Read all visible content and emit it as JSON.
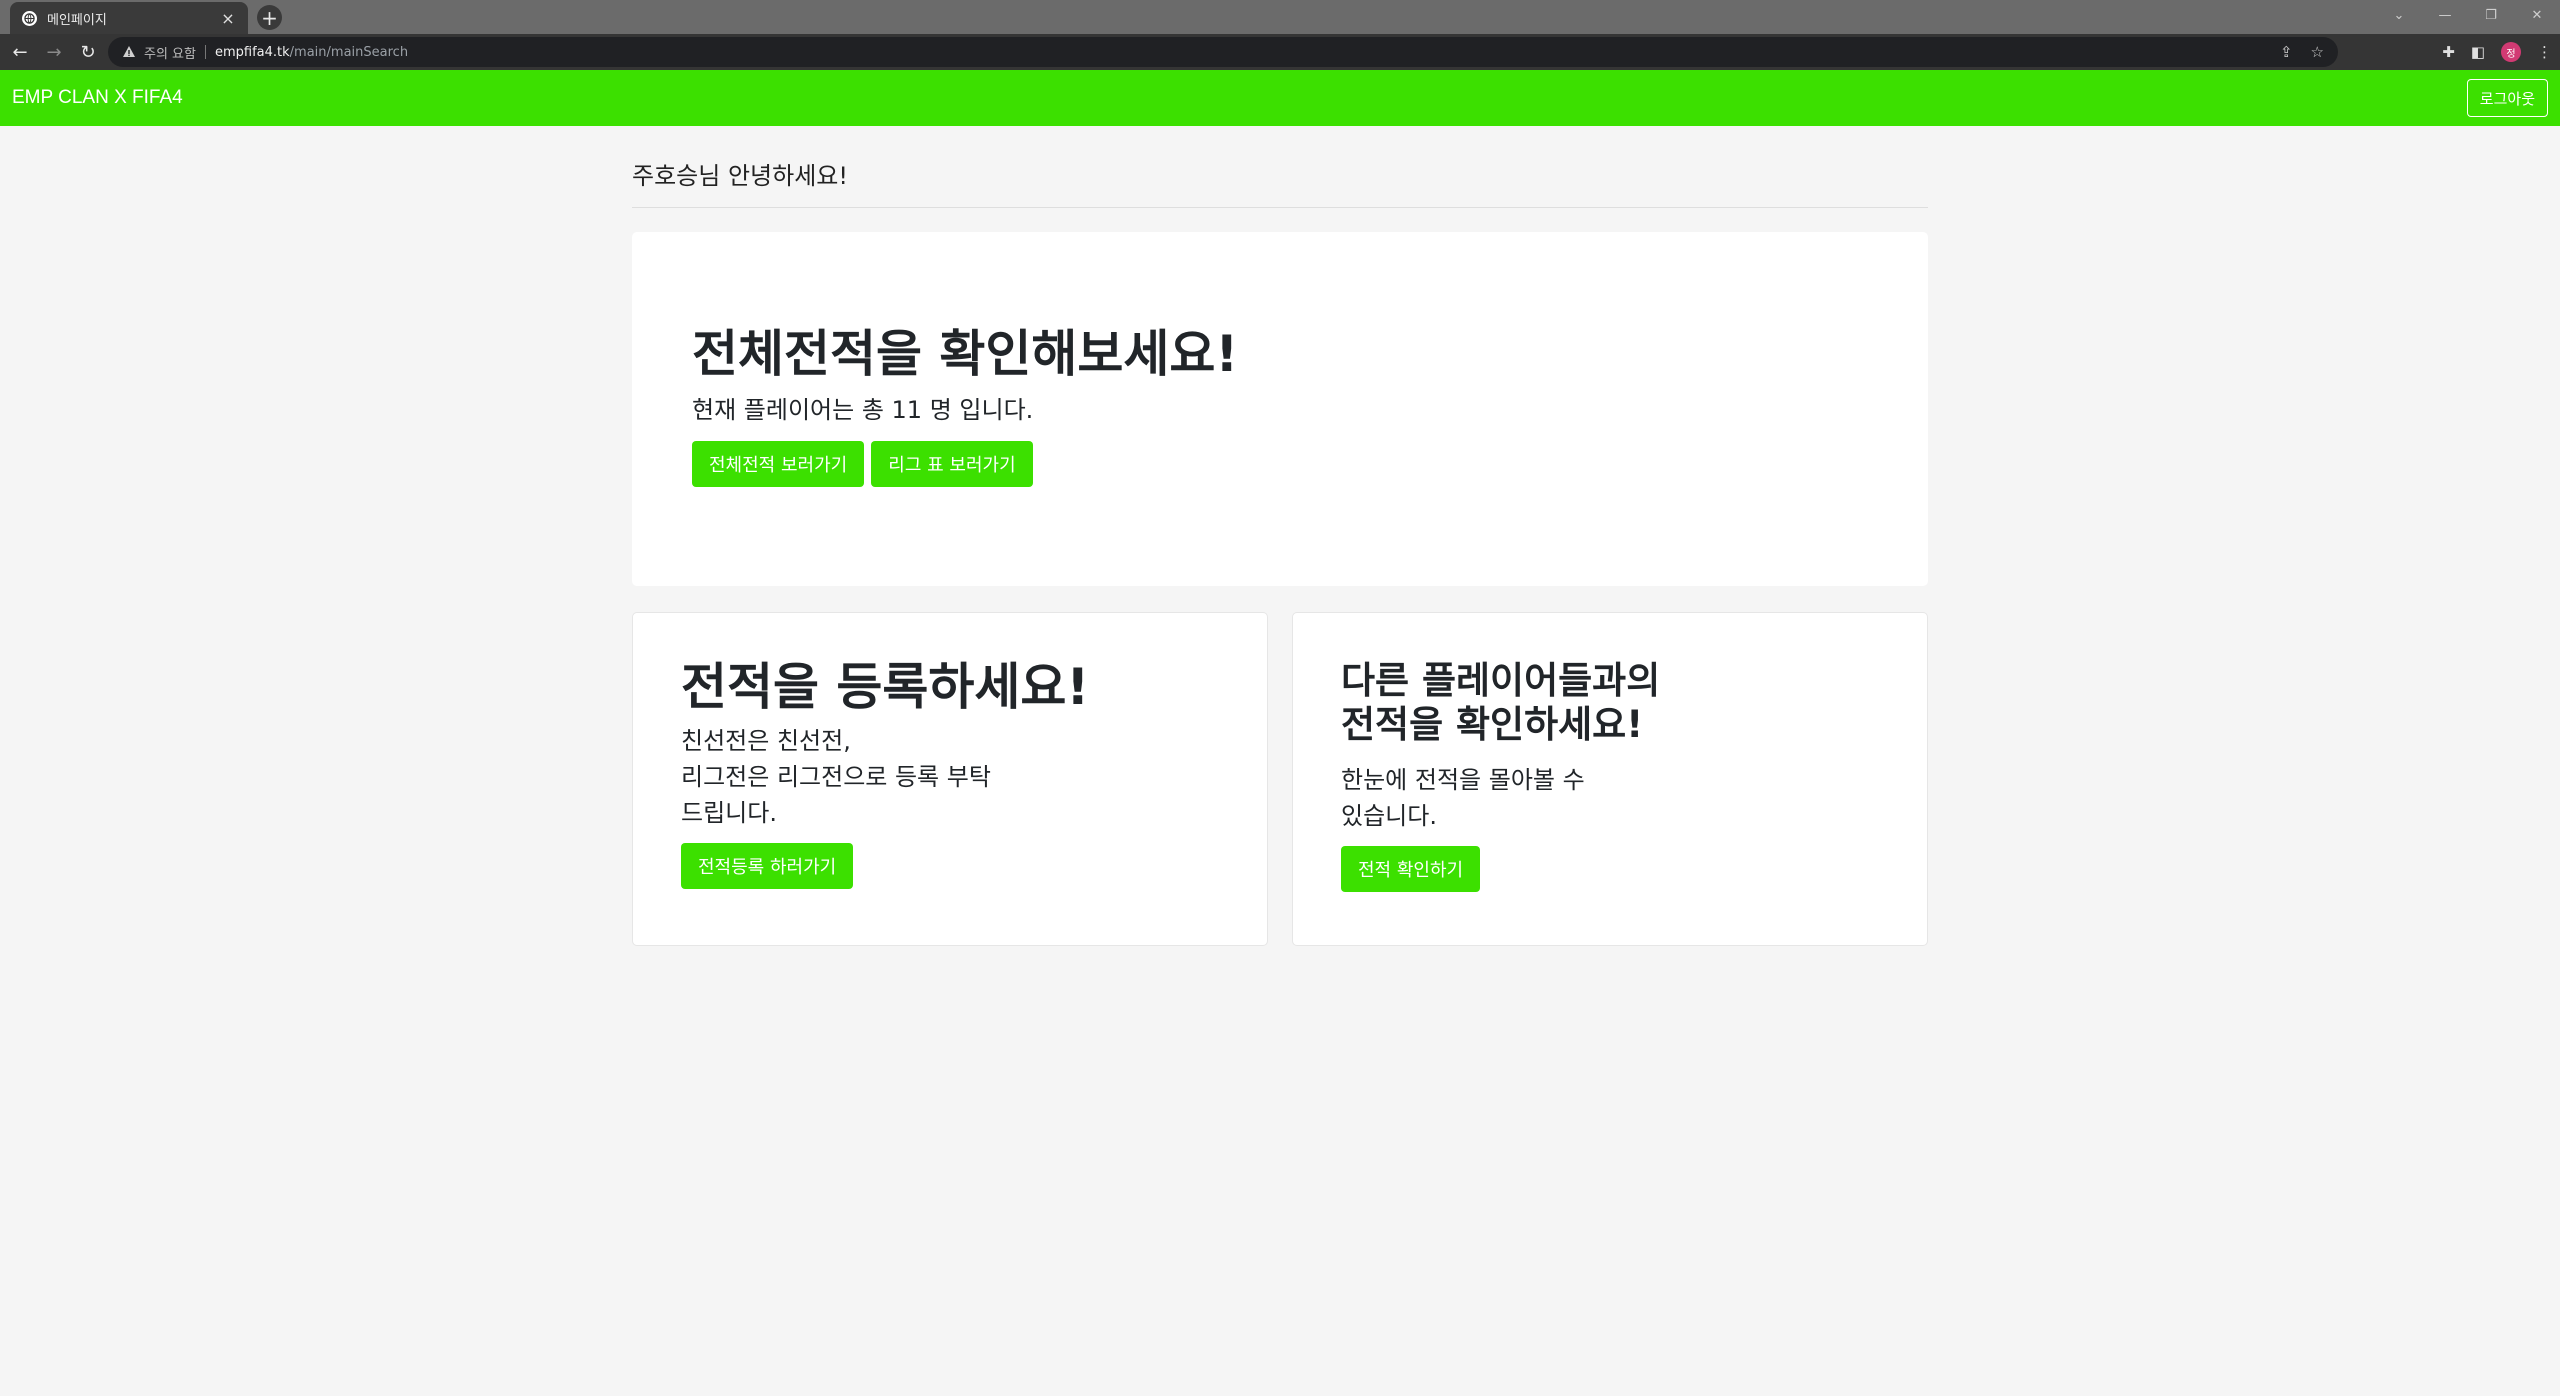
{
  "browser": {
    "tab_title": "메인페이지",
    "tab_close": "×",
    "new_tab": "+",
    "security_warning": "주의 요함",
    "url_host": "empfifa4.tk",
    "url_path": "/main/mainSearch",
    "profile_initial": "정"
  },
  "navbar": {
    "brand": "EMP CLAN X FIFA4",
    "logout_label": "로그아웃"
  },
  "greeting": "주호승님 안녕하세요!",
  "jumbotron": {
    "title": "전체전적을 확인해보세요!",
    "lead": "현재 플레이어는 총 11 명 입니다.",
    "buttons": [
      {
        "label": "전체전적 보러가기"
      },
      {
        "label": "리그 표 보러가기"
      }
    ]
  },
  "cards": [
    {
      "title": "전적을 등록하세요!",
      "text_lines": [
        "친선전은 친선전,",
        "리그전은 리그전으로 등록 부탁",
        "드립니다."
      ],
      "button": "전적등록 하러가기"
    },
    {
      "title_lines": [
        "다른 플레이어들과의",
        "전적을 확인하세요!"
      ],
      "text_lines": [
        "한눈에 전적을 몰아볼 수",
        "있습니다."
      ],
      "button": "전적 확인하기"
    }
  ],
  "colors": {
    "brand_green": "#3ce000",
    "page_background": "#f5f5f5"
  },
  "icons": [
    "globe-icon",
    "close-icon",
    "plus-icon",
    "back-arrow-icon",
    "forward-arrow-icon",
    "reload-icon",
    "warning-icon",
    "share-icon",
    "star-icon",
    "extensions-icon",
    "sidepanel-icon",
    "menu-icon"
  ]
}
